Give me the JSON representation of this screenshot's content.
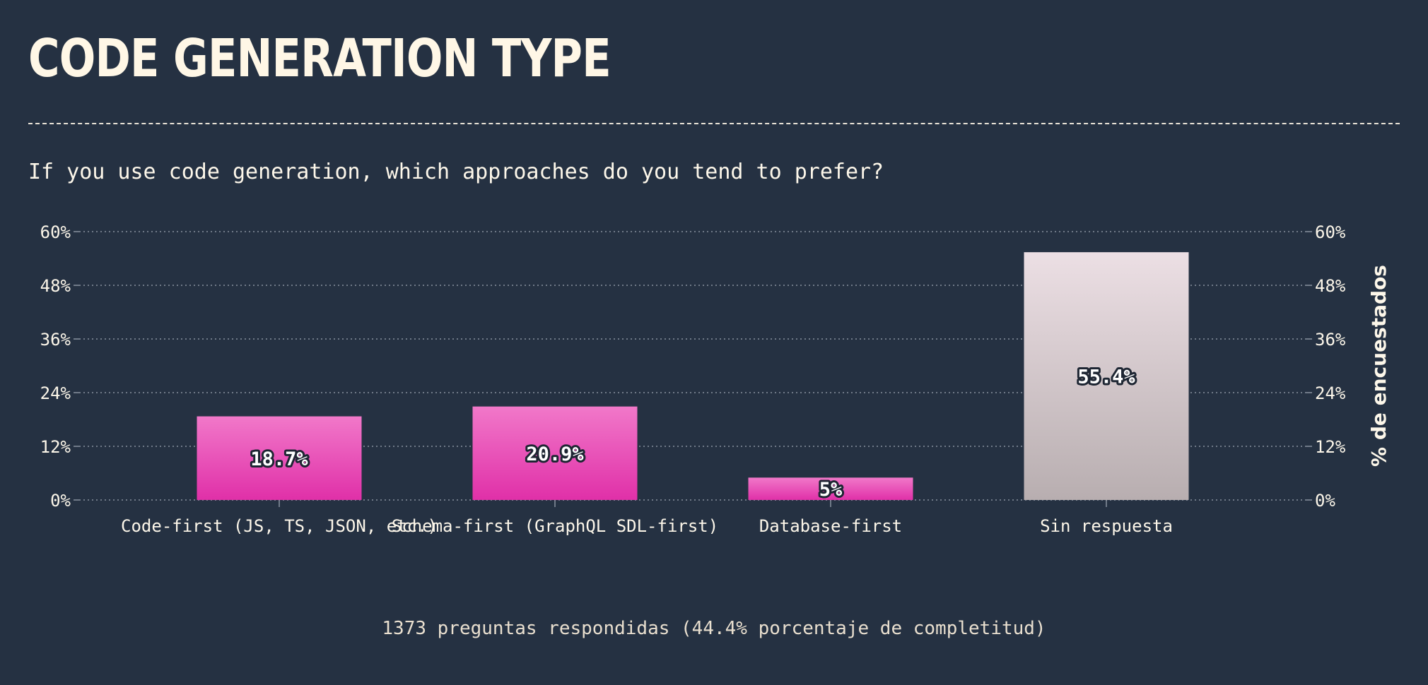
{
  "title": "CODE GENERATION TYPE",
  "question": "If you use code generation, which approaches do you tend to prefer?",
  "footer": "1373 preguntas respondidas (44.4% porcentaje de completitud)",
  "colors": {
    "background": "#253142",
    "bar_primary_top": "#f178c9",
    "bar_primary_bottom": "#e030a8",
    "bar_noanswer_top": "#ecdfe4",
    "bar_noanswer_bottom": "#b8aeb0",
    "text": "#fdf7ea",
    "grid": "#8a93a0"
  },
  "chart_data": {
    "type": "bar",
    "categories": [
      "Code-first (JS, TS, JSON, etc.)",
      "Schema-first (GraphQL SDL-first)",
      "Database-first",
      "Sin respuesta"
    ],
    "values": [
      18.7,
      20.9,
      5,
      55.4
    ],
    "value_labels": [
      "18.7%",
      "20.9%",
      "5%",
      "55.4%"
    ],
    "ylim": [
      0,
      60
    ],
    "yticks": [
      0,
      12,
      24,
      36,
      48,
      60
    ],
    "ytick_labels": [
      "0%",
      "12%",
      "24%",
      "36%",
      "48%",
      "60%"
    ],
    "ylabel_right": "% de encuestados",
    "grid": true,
    "highlight_category": "Sin respuesta"
  }
}
